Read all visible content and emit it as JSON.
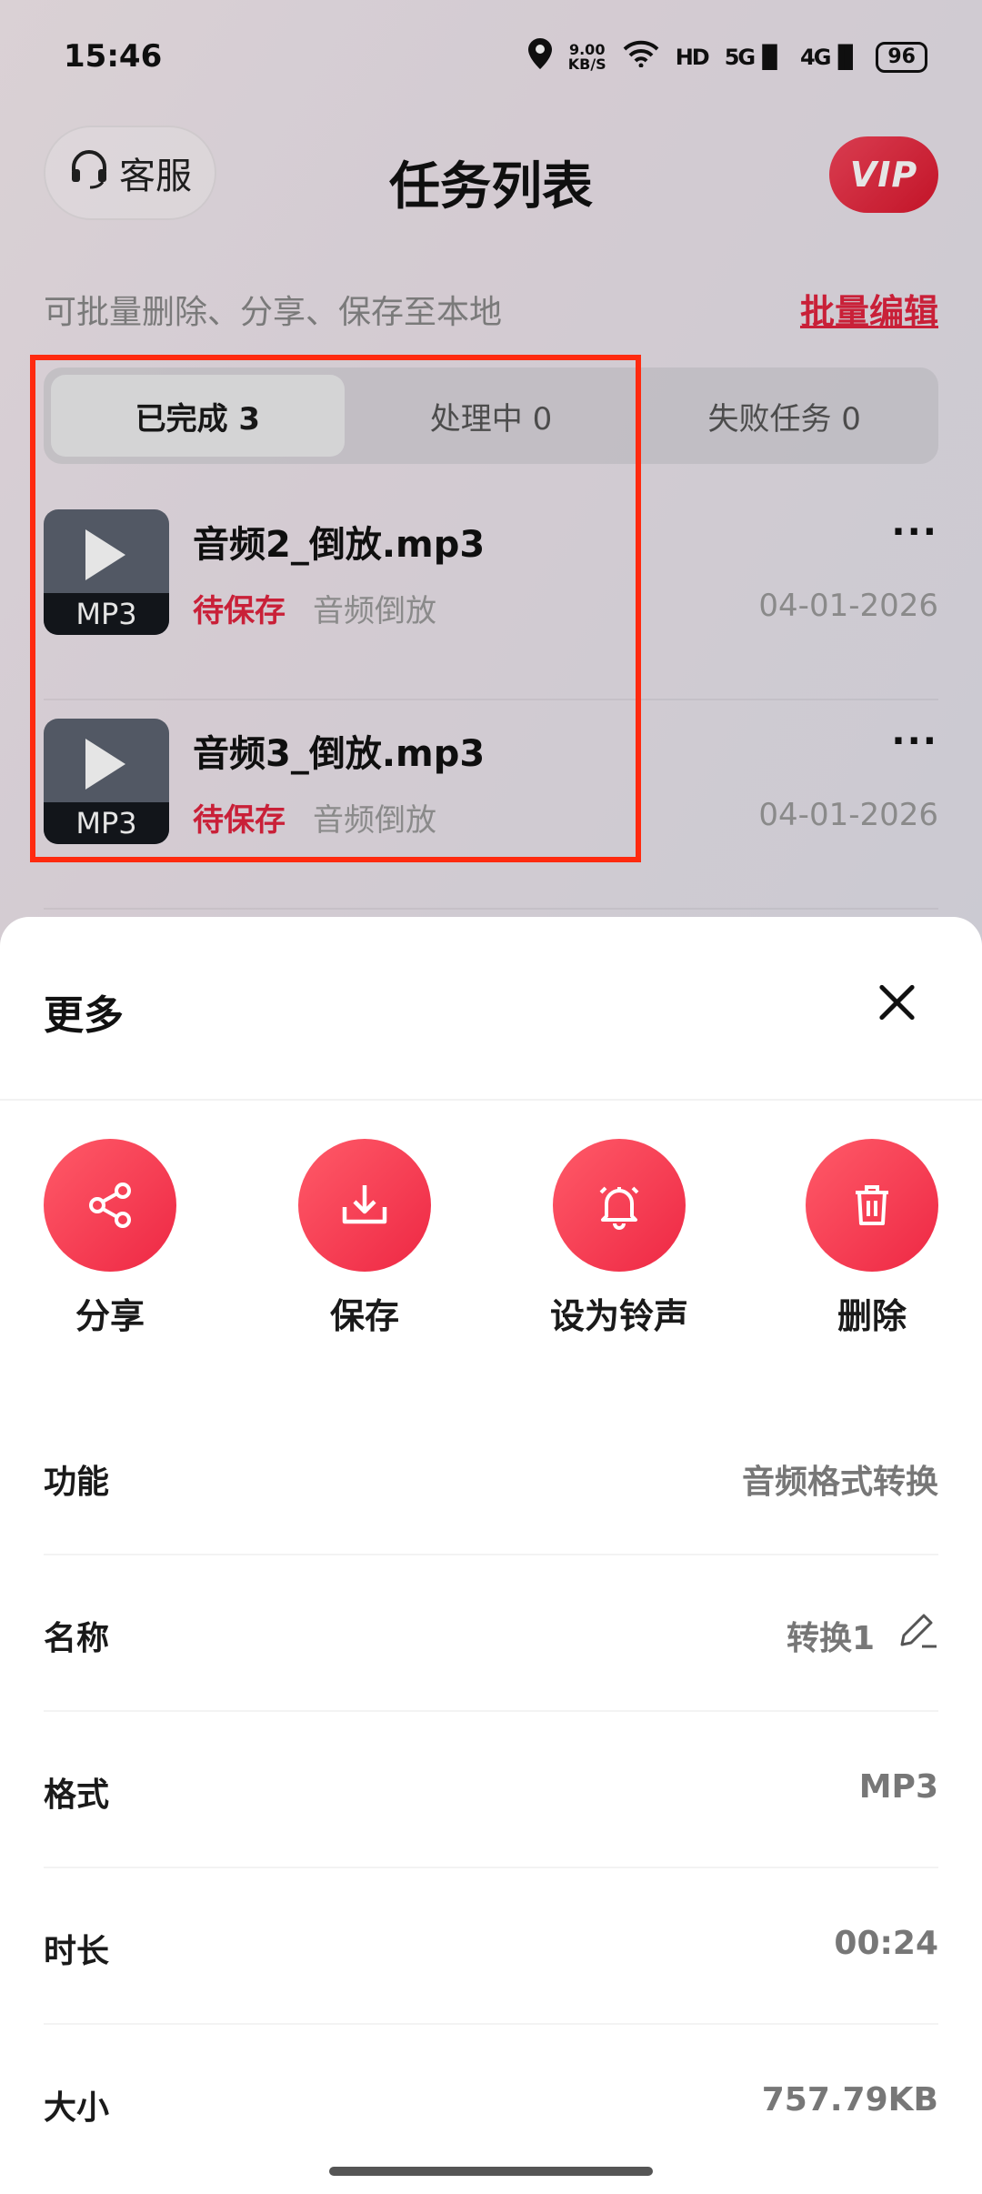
{
  "status_bar": {
    "time": "15:46",
    "net_speed_value": "9.00",
    "net_speed_unit": "KB/S",
    "hd_label": "HD",
    "sig1": "5G",
    "sig2": "4G",
    "battery": "96"
  },
  "header": {
    "service_label": "客服",
    "title": "任务列表",
    "vip_label": "VIP"
  },
  "hint": {
    "text": "可批量删除、分享、保存至本地",
    "batch_edit": "批量编辑"
  },
  "tabs": [
    {
      "label": "已完成 3",
      "active": true
    },
    {
      "label": "处理中 0",
      "active": false
    },
    {
      "label": "失败任务 0",
      "active": false
    }
  ],
  "tasks": [
    {
      "format": "MP3",
      "name": "音频2_倒放.mp3",
      "status": "待保存",
      "function": "音频倒放",
      "date": "04-01-2026",
      "more": "···"
    },
    {
      "format": "MP3",
      "name": "音频3_倒放.mp3",
      "status": "待保存",
      "function": "音频倒放",
      "date": "04-01-2026",
      "more": "···"
    }
  ],
  "sheet": {
    "title": "更多",
    "actions": [
      {
        "label": "分享",
        "icon": "share-icon"
      },
      {
        "label": "保存",
        "icon": "download-icon"
      },
      {
        "label": "设为铃声",
        "icon": "bell-icon"
      },
      {
        "label": "删除",
        "icon": "trash-icon"
      }
    ],
    "info": {
      "function_label": "功能",
      "function_value": "音频格式转换",
      "name_label": "名称",
      "name_value": "转换1",
      "format_label": "格式",
      "format_value": "MP3",
      "duration_label": "时长",
      "duration_value": "00:24",
      "size_label": "大小",
      "size_value": "757.79KB"
    }
  },
  "colors": {
    "accent": "#e0243f",
    "highlight_box": "#ff2a0f"
  }
}
